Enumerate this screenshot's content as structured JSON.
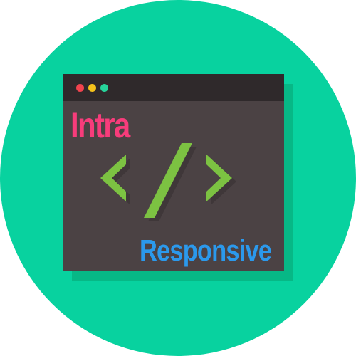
{
  "colors": {
    "circle_background": "#08d29f",
    "window_shadow": "#07b886",
    "window_body": "#4b4244",
    "titlebar": "#2f292b",
    "dot_red": "#f2434e",
    "dot_yellow": "#f5c21b",
    "dot_green": "#27d39a",
    "code_icon": "#7cc242",
    "code_icon_shadow": "#3f3739",
    "title_text": "#f73c7b",
    "subtitle_text": "#2b99ec"
  },
  "window": {
    "title": "Intra",
    "subtitle": "Responsive",
    "traffic_lights": [
      "red",
      "yellow",
      "green"
    ],
    "center_icon": "code-brackets-icon"
  }
}
